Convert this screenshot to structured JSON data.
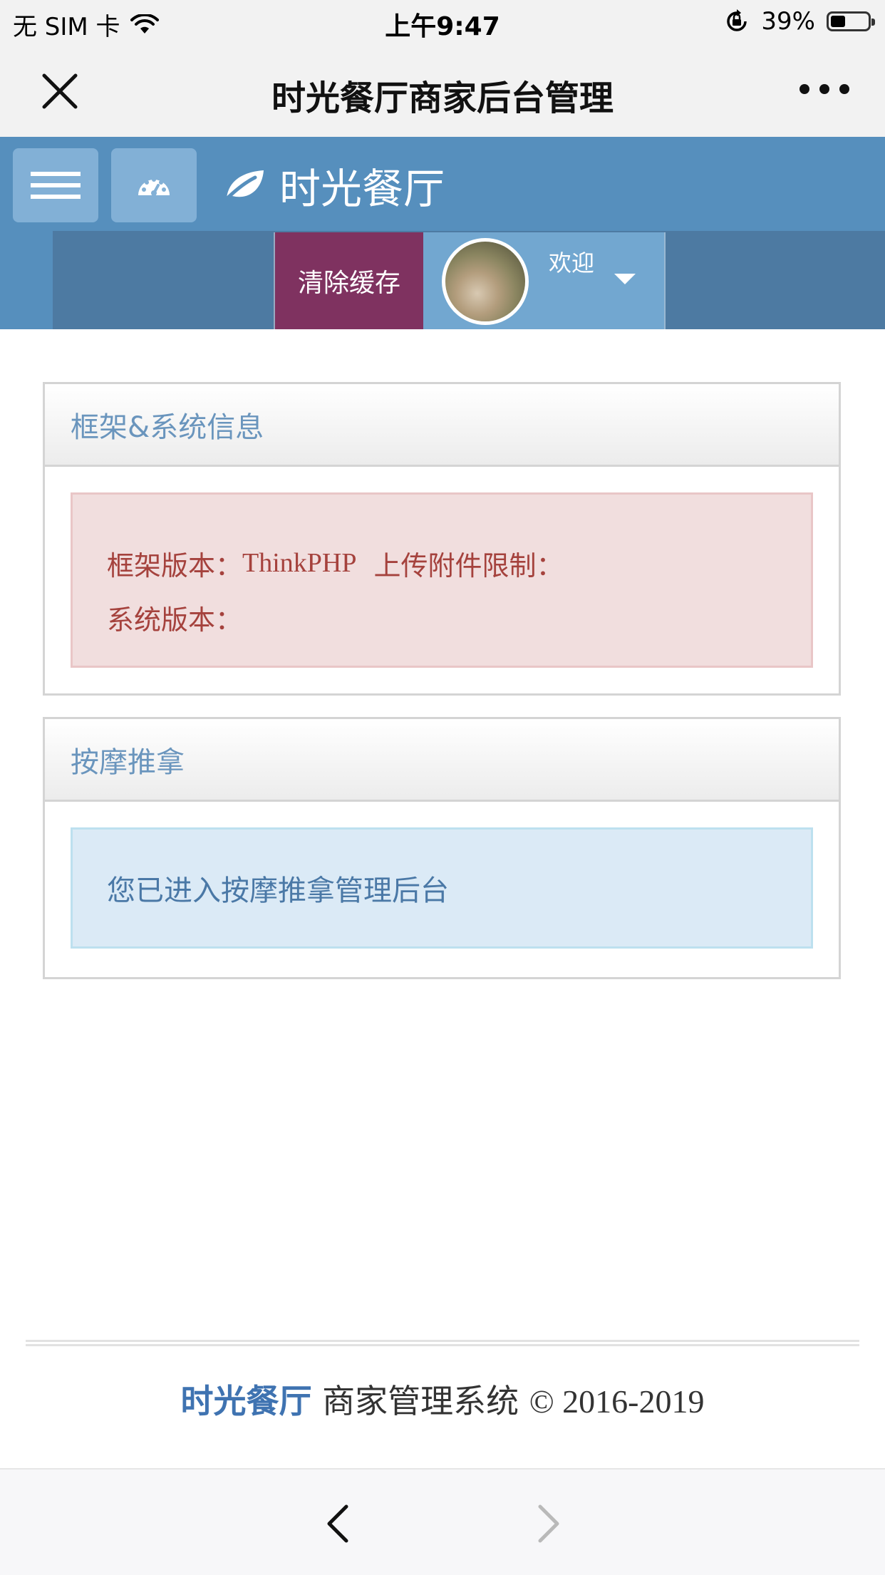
{
  "status_bar": {
    "carrier": "无 SIM 卡",
    "time": "上午9:47",
    "battery_percent": "39%",
    "battery_level": 0.39
  },
  "wechat_nav": {
    "title": "时光餐厅商家后台管理",
    "close_icon": "close-icon",
    "more_icon": "more-dots-icon"
  },
  "header": {
    "brand": "时光餐厅",
    "brand_icon": "leaf-icon",
    "menu_icon": "hamburger-icon",
    "dashboard_icon": "dashboard-gauge-icon",
    "clear_cache": "清除缓存",
    "welcome": "欢迎",
    "colors": {
      "header_bg": "#568fbd",
      "clear_cache_bg": "#7f3260",
      "user_box_bg": "#72a7d0"
    }
  },
  "panels": [
    {
      "title": "框架&系统信息",
      "framework_label": "框架版本：",
      "framework_value": "ThinkPHP",
      "upload_label": "上传附件限制：",
      "system_label": "系统版本："
    },
    {
      "title": "按摩推拿",
      "message": "您已进入按摩推拿管理后台"
    }
  ],
  "footer": {
    "brand": "时光餐厅",
    "system_name": "商家管理系统",
    "copyright": "© 2016-2019"
  },
  "bottom_bar": {
    "back_icon": "chevron-left-icon",
    "forward_icon": "chevron-right-icon"
  }
}
